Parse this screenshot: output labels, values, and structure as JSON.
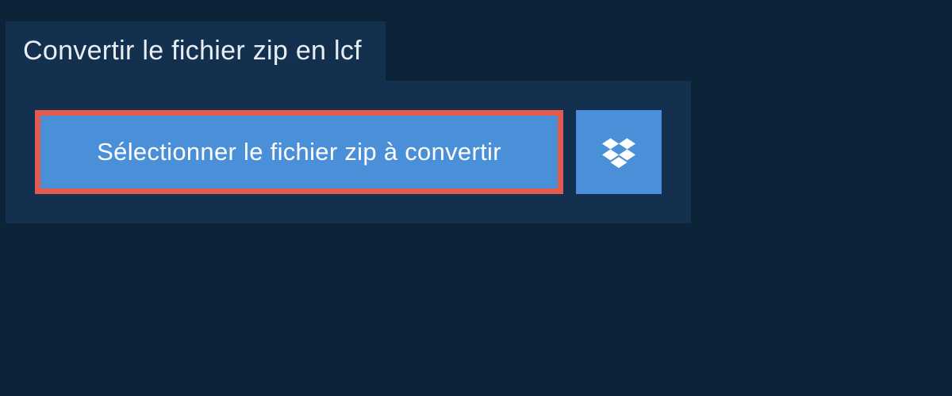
{
  "header": {
    "title": "Convertir le fichier zip en lcf"
  },
  "panel": {
    "select_button_label": "Sélectionner le fichier zip à convertir",
    "dropbox_icon_name": "dropbox"
  },
  "colors": {
    "background": "#0d2438",
    "panel": "#13314f",
    "button": "#4a90d9",
    "highlight_border": "#e15b4e",
    "text_light": "#e8eef3",
    "text_white": "#ffffff"
  }
}
